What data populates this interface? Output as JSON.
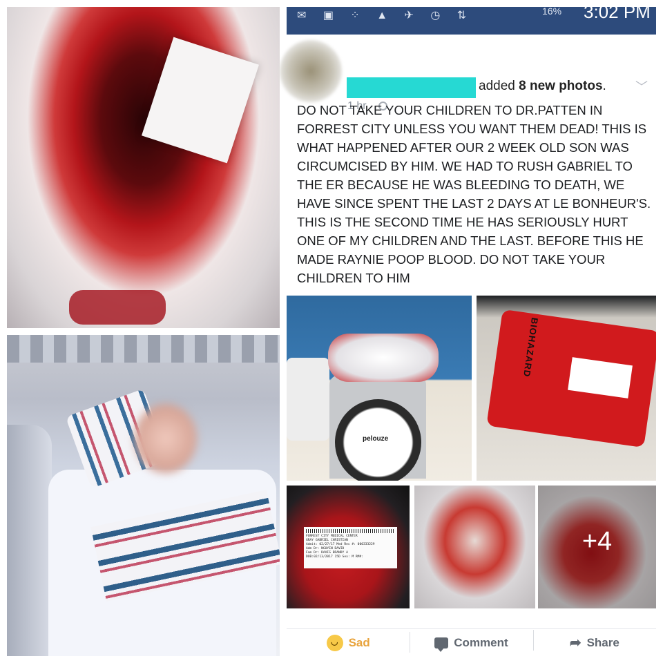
{
  "statusbar": {
    "battery": "16%",
    "time": "3:02 PM"
  },
  "post": {
    "action_prefix": " added ",
    "photo_count_text": "8 new photos",
    "action_suffix": ".",
    "time_ago": "1 hr ·",
    "text": "DO NOT TAKE YOUR CHILDREN TO DR.PATTEN IN FORREST CITY UNLESS YOU WANT THEM DEAD! THIS IS WHAT HAPPENED AFTER OUR 2 WEEK OLD SON WAS CIRCUMCISED BY HIM. WE HAD TO RUSH GABRIEL TO THE ER BECAUSE HE WAS BLEEDING TO DEATH, WE HAVE SINCE SPENT THE LAST 2 DAYS AT LE BONHEUR'S. THIS IS THE SECOND TIME HE HAS SERIOUSLY HURT ONE OF MY CHILDREN AND THE LAST. BEFORE THIS HE MADE RAYNIE POOP BLOOD. DO NOT TAKE YOUR CHILDREN TO HIM"
  },
  "photos": {
    "scale_brand": "pelouze",
    "bag_label": "BIOHAZARD",
    "more_count": "+4",
    "wristband": {
      "line1": "FORREST CITY MEDICAL CENTER",
      "line2": "GRAY GABRIEL CHRISTIAN",
      "line3": "Admit: 02/27/17 Med Rec #: 000333229",
      "line4": "Adm Dr: NGUYEN DAVID",
      "line5": "Fam Dr: DAVIS BRANDY A",
      "line6": "DOB:02/13/2017 15D Sex: M RM#:"
    }
  },
  "actions": {
    "sad": "Sad",
    "comment": "Comment",
    "share": "Share"
  }
}
